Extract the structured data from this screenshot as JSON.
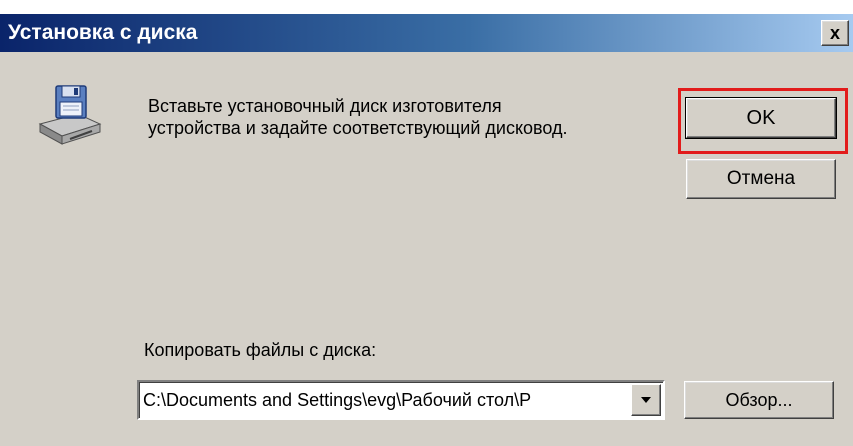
{
  "window": {
    "title": "Установка с диска",
    "close_glyph": "x"
  },
  "message": {
    "line1": "Вставьте установочный диск изготовителя",
    "line2": "устройства и задайте соответствующий дисковод."
  },
  "buttons": {
    "ok_label": "OK",
    "cancel_label": "Отмена",
    "browse_label": "Обзор..."
  },
  "copy_from": {
    "label": "Копировать файлы с диска:",
    "value": "C:\\Documents and Settings\\evg\\Рабочий стол\\P"
  },
  "icons": {
    "disk": "install-disk-icon",
    "dropdown": "chevron-down-icon"
  },
  "colors": {
    "dialog_bg": "#d4d0c8",
    "titlebar_start": "#0a246a",
    "titlebar_end": "#a6caf0",
    "highlight": "#e21b1b"
  }
}
